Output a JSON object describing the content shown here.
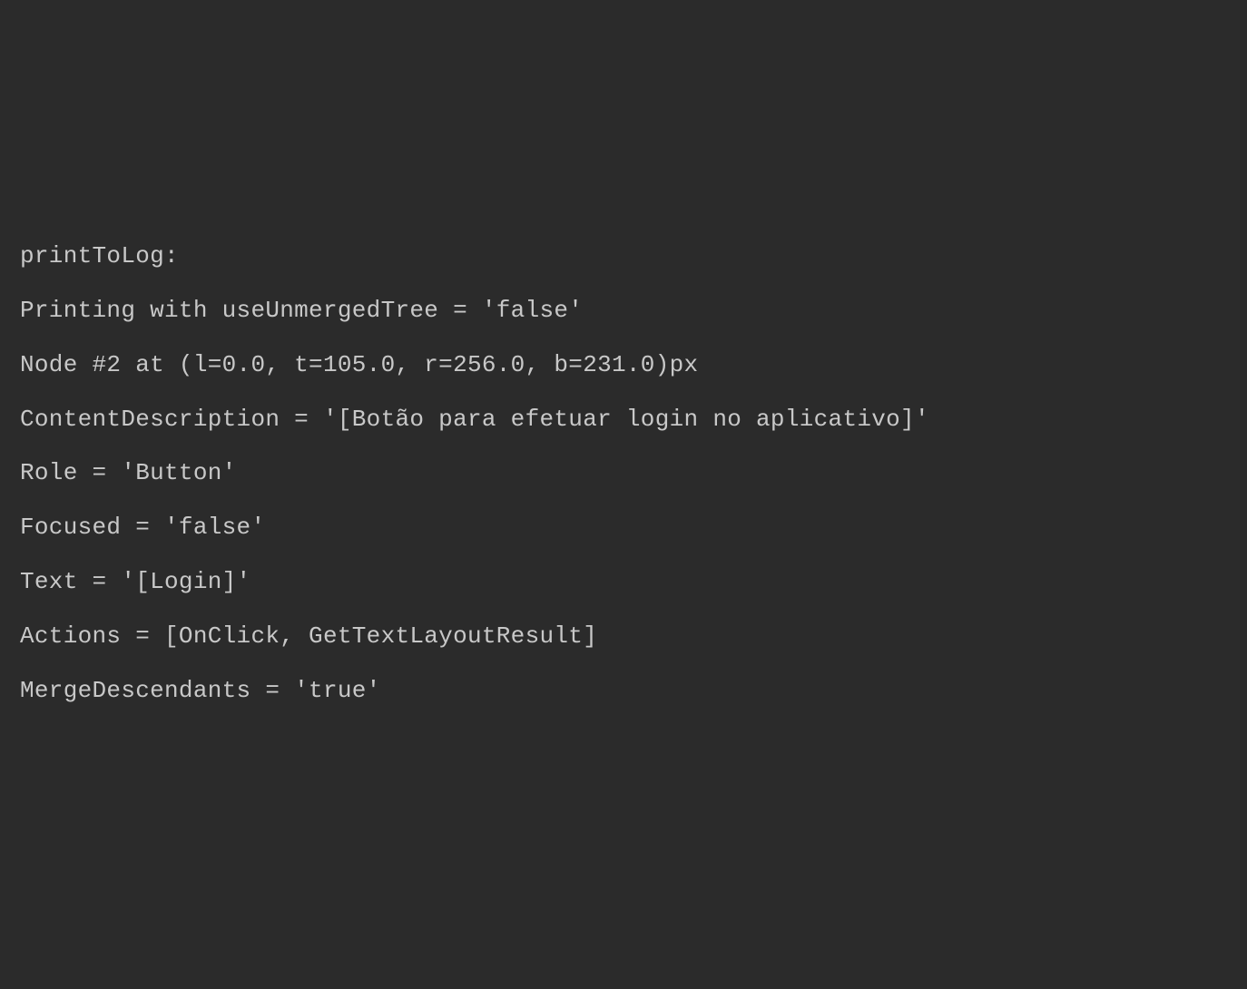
{
  "lines": {
    "l0": "printToLog:",
    "l1": "Printing with useUnmergedTree = 'false'",
    "l2": "Node #2 at (l=0.0, t=105.0, r=256.0, b=231.0)px",
    "l3": "ContentDescription = '[Botão para efetuar login no aplicativo]'",
    "l4": "Role = 'Button'",
    "l5": "Focused = 'false'",
    "l6": "Text = '[Login]'",
    "l7": "Actions = [OnClick, GetTextLayoutResult]",
    "l8": "MergeDescendants = 'true'"
  }
}
